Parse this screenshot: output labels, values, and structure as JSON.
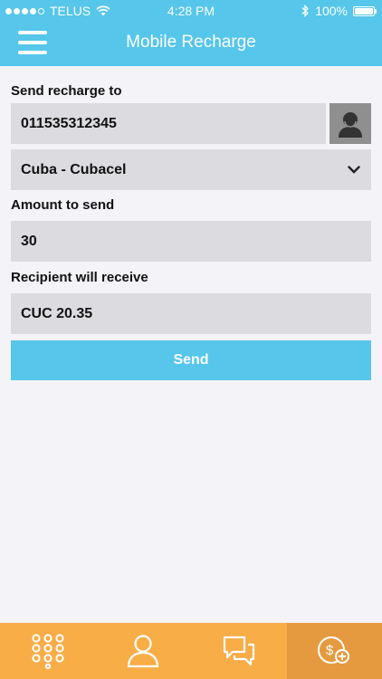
{
  "status_bar": {
    "carrier": "TELUS",
    "time": "4:28 PM",
    "battery": "100%"
  },
  "nav": {
    "title": "Mobile Recharge"
  },
  "form": {
    "send_to_label": "Send recharge to",
    "phone_value": "011535312345",
    "operator_value": "Cuba - Cubacel",
    "amount_label": "Amount to send",
    "amount_value": "30",
    "receive_label": "Recipient will receive",
    "receive_value": "CUC 20.35",
    "send_button": "Send"
  },
  "tabs": [
    {
      "icon": "keypad-icon",
      "active": false
    },
    {
      "icon": "person-icon",
      "active": false
    },
    {
      "icon": "chat-icon",
      "active": false
    },
    {
      "icon": "dollar-plus-icon",
      "active": true
    }
  ],
  "colors": {
    "accent": "#56c6ea",
    "tabbar": "#f8ad47",
    "tab_active": "#e69a40",
    "field_bg": "#dcdce0"
  }
}
